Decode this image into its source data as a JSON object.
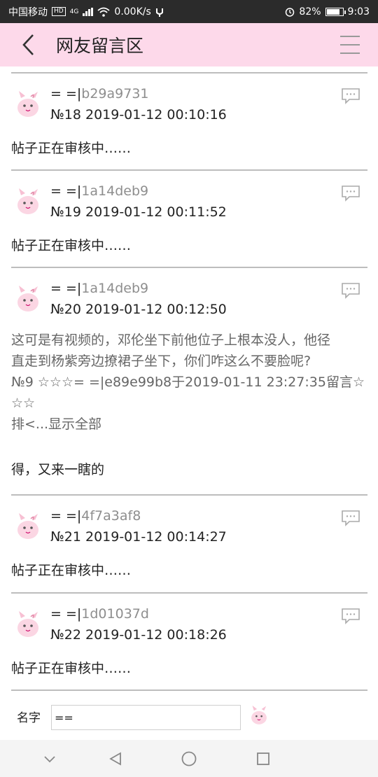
{
  "status_bar": {
    "carrier": "中国移动",
    "hd": "HD",
    "network": "4G",
    "speed": "0.00K/s",
    "battery": "82%",
    "battery_level": 0.82,
    "time": "9:03"
  },
  "header": {
    "title": "网友留言区",
    "back_icon": "chevron-left-icon",
    "menu_icon": "hamburger-menu-icon"
  },
  "comments": [
    {
      "prefix": "= =|",
      "uid": "b29a9731",
      "meta": "№18  2019-01-12 00:10:16",
      "body": "帖子正在审核中……"
    },
    {
      "prefix": "= =|",
      "uid": "1a14deb9",
      "meta": "№19  2019-01-12 00:11:52",
      "body": "帖子正在审核中……"
    },
    {
      "prefix": "= =|",
      "uid": "1a14deb9",
      "meta": "№20  2019-01-12 00:12:50",
      "quote_lines": [
        "这可是有视频的，邓伦坐下前他位子上根本没人，他径",
        "直走到杨紫旁边撩裙子坐下，你们咋这么不要脸呢?",
        "№9 ☆☆☆= =|e89e99b8于2019-01-11 23:27:35留言☆",
        "☆☆",
        "排<...显示全部"
      ],
      "body": "得，又来一瞎的"
    },
    {
      "prefix": "= =|",
      "uid": "4f7a3af8",
      "meta": "№21  2019-01-12 00:14:27",
      "body": "帖子正在审核中……"
    },
    {
      "prefix": "= =|",
      "uid": "1d01037d",
      "meta": "№22  2019-01-12 00:18:26",
      "body": "帖子正在审核中……"
    }
  ],
  "input_bar": {
    "name_label": "名字",
    "name_value": "=="
  },
  "colors": {
    "header_bg": "#fdd9ea",
    "uid_gray": "#8e8e8e",
    "divider": "#bdbdbd"
  }
}
